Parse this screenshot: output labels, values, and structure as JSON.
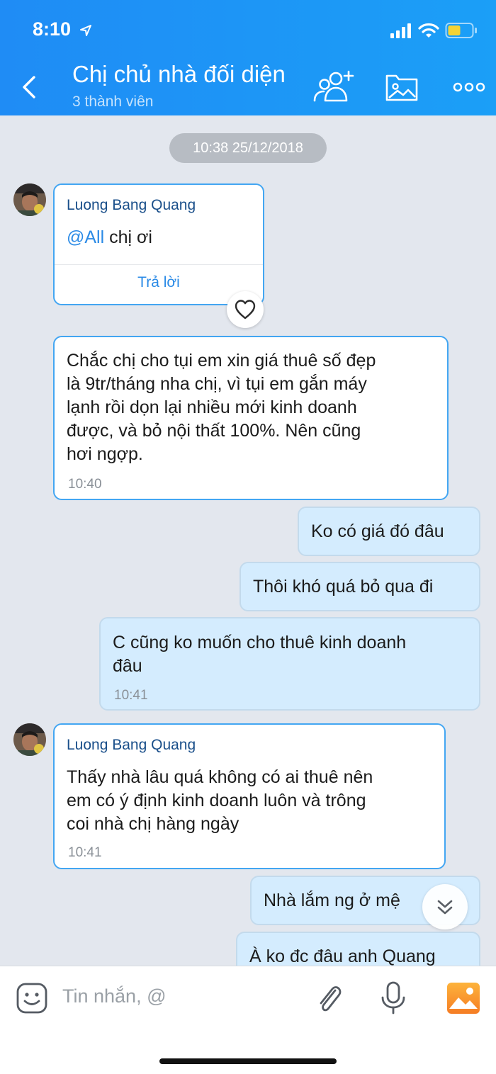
{
  "status_bar": {
    "time": "8:10"
  },
  "header": {
    "title": "Chị chủ nhà đối diện",
    "subtitle": "3 thành viên"
  },
  "date_separator": "10:38 25/12/2018",
  "messages": [
    {
      "sender": "Luong Bang Quang",
      "mention": "@All",
      "text": " chị ơi",
      "reply_label": "Trả lời"
    },
    {
      "text_lines": [
        "Chắc chị cho tụi em xin giá thuê số đẹp",
        "là 9tr/tháng nha chị, vì tụi em gắn máy",
        "lạnh rồi dọn lại nhiều mới kinh doanh",
        "được, và bỏ nội thất 100%. Nên cũng",
        "hơi ngợp."
      ],
      "time": "10:40"
    },
    {
      "text": "Ko có giá đó đâu"
    },
    {
      "text": "Thôi khó quá bỏ qua đi"
    },
    {
      "text_lines": [
        "C cũng ko muốn cho thuê kinh doanh",
        "đâu"
      ],
      "time": "10:41"
    },
    {
      "sender": "Luong Bang Quang",
      "text_lines": [
        "Thấy nhà lâu quá không có ai thuê nên",
        "em có ý định kinh doanh luôn và trông",
        "coi nhà chị hàng ngày"
      ],
      "time": "10:41"
    },
    {
      "text": "Nhà lắm ng ở mệ"
    },
    {
      "text": "À ko đc đâu anh Quang"
    }
  ],
  "input": {
    "placeholder": "Tin nhắn, @"
  },
  "colors": {
    "header": "#1f8cf5",
    "accent": "#2a8ae6",
    "mine_bubble": "#d4ecfe",
    "chat_bg": "#e3e7ee"
  },
  "icons": [
    "location-arrow-icon",
    "signal-icon",
    "wifi-icon",
    "battery-icon",
    "back-icon",
    "add-member-icon",
    "media-folder-icon",
    "more-icon",
    "heart-icon",
    "scroll-down-icon",
    "sticker-icon",
    "attach-icon",
    "mic-icon",
    "image-icon"
  ]
}
